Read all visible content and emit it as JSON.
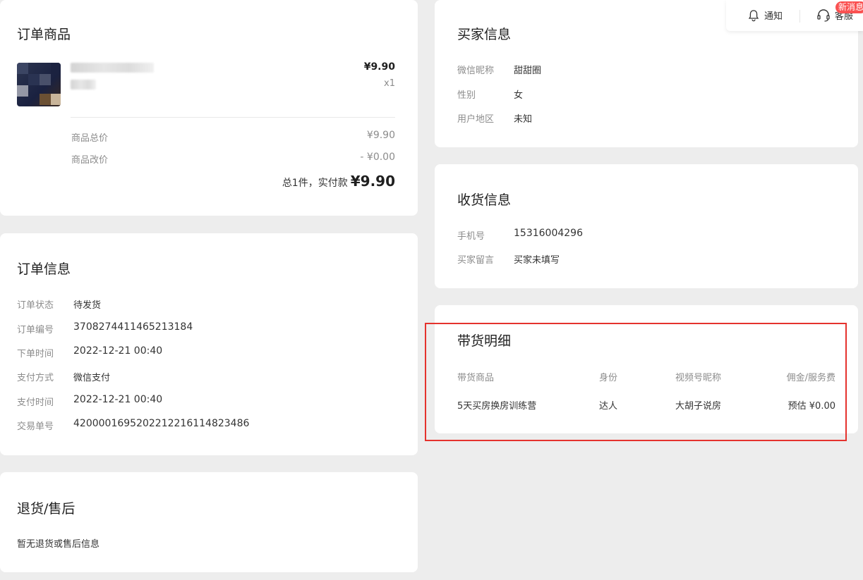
{
  "order_goods": {
    "title": "订单商品",
    "item": {
      "price": "¥9.90",
      "quantity": "x1"
    },
    "total_label": "商品总价",
    "total_value": "¥9.90",
    "adjust_label": "商品改价",
    "adjust_value": "- ¥0.00",
    "summary_prefix": "总1件，实付款",
    "summary_amount": "¥9.90"
  },
  "order_info": {
    "title": "订单信息",
    "rows": [
      {
        "label": "订单状态",
        "value": "待发货"
      },
      {
        "label": "订单编号",
        "value": "3708274411465213184"
      },
      {
        "label": "下单时间",
        "value": "2022-12-21 00:40"
      },
      {
        "label": "支付方式",
        "value": "微信支付"
      },
      {
        "label": "支付时间",
        "value": "2022-12-21 00:40"
      },
      {
        "label": "交易单号",
        "value": "4200001695202212216114823486"
      }
    ]
  },
  "after_sales": {
    "title": "退货/售后",
    "text": "暂无退货或售后信息"
  },
  "buyer_info": {
    "title": "买家信息",
    "rows": [
      {
        "label": "微信昵称",
        "value": "甜甜圈"
      },
      {
        "label": "性别",
        "value": "女"
      },
      {
        "label": "用户地区",
        "value": "未知"
      }
    ]
  },
  "shipping_info": {
    "title": "收货信息",
    "rows": [
      {
        "label": "手机号",
        "value": "15316004296"
      },
      {
        "label": "买家留言",
        "value": "买家未填写"
      }
    ]
  },
  "commission": {
    "title": "带货明细",
    "headers": [
      "带货商品",
      "身份",
      "视频号昵称",
      "佣金/服务费"
    ],
    "row": [
      "5天买房换房训练营",
      "达人",
      "大胡子说房",
      "预估 ¥0.00"
    ]
  },
  "toolbar": {
    "notify_label": "通知",
    "service_label": "客服",
    "badge": "新消息"
  },
  "colors": {
    "badge": "#fa5151",
    "highlight": "#e5322d",
    "background": "#ededed"
  }
}
